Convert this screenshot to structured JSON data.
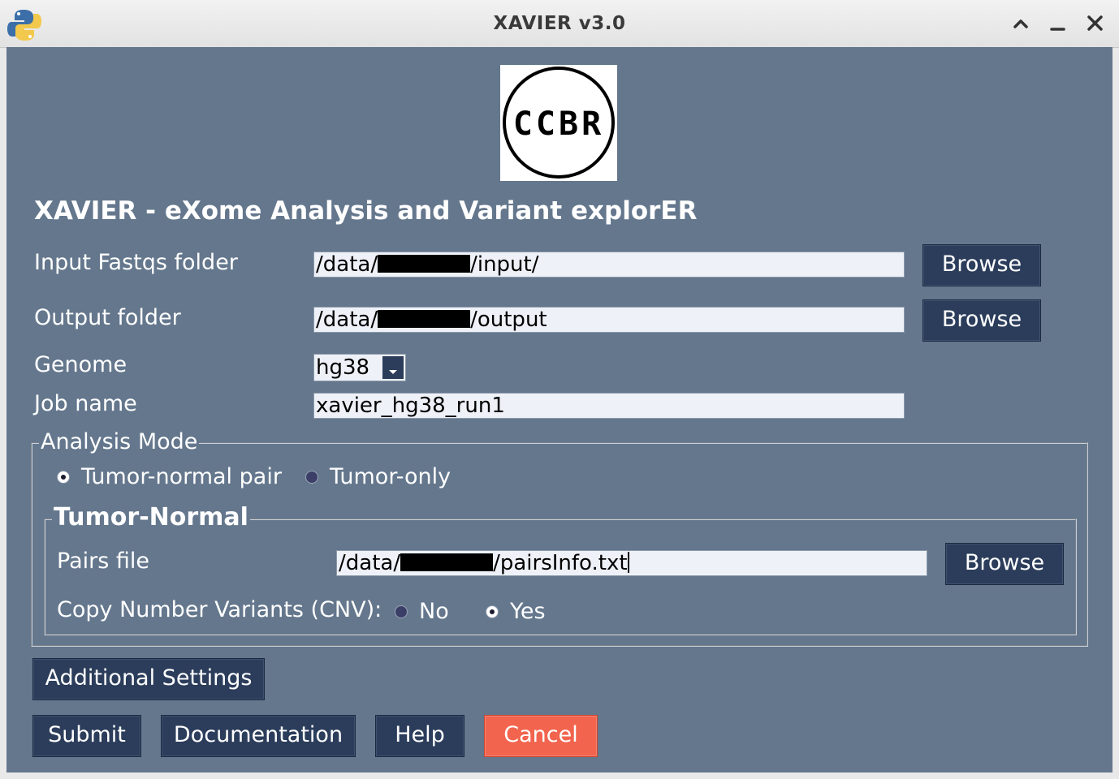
{
  "window": {
    "title": "XAVIER v3.0",
    "controls": [
      "maximize-icon",
      "minimize-icon",
      "close-icon"
    ]
  },
  "logo": {
    "text": "CCBR"
  },
  "heading": "XAVIER - eXome Analysis and Variant explorER",
  "form": {
    "input_fastqs": {
      "label": "Input Fastqs folder",
      "value_prefix": "/data/",
      "value_suffix": "/input/",
      "browse_label": "Browse"
    },
    "output_folder": {
      "label": "Output folder",
      "value_prefix": "/data/",
      "value_suffix": "/output",
      "browse_label": "Browse"
    },
    "genome": {
      "label": "Genome",
      "selected": "hg38"
    },
    "job_name": {
      "label": "Job name",
      "value": "xavier_hg38_run1"
    }
  },
  "analysis_mode": {
    "legend": "Analysis Mode",
    "options": [
      {
        "label": "Tumor-normal pair",
        "checked": true
      },
      {
        "label": "Tumor-only",
        "checked": false
      }
    ]
  },
  "tumor_normal": {
    "legend": "Tumor-Normal",
    "pairs_file": {
      "label": "Pairs file",
      "value_prefix": "/data/",
      "value_suffix": "/pairsInfo.txt",
      "browse_label": "Browse"
    },
    "cnv": {
      "label": "Copy Number Variants (CNV):",
      "options": [
        {
          "label": "No",
          "checked": false
        },
        {
          "label": "Yes",
          "checked": true
        }
      ]
    }
  },
  "buttons": {
    "additional_settings": "Additional Settings",
    "submit": "Submit",
    "documentation": "Documentation",
    "help": "Help",
    "cancel": "Cancel"
  },
  "colors": {
    "background": "#64778d",
    "button": "#2b3d5b",
    "cancel": "#f2644e",
    "field": "#eef2f8"
  }
}
